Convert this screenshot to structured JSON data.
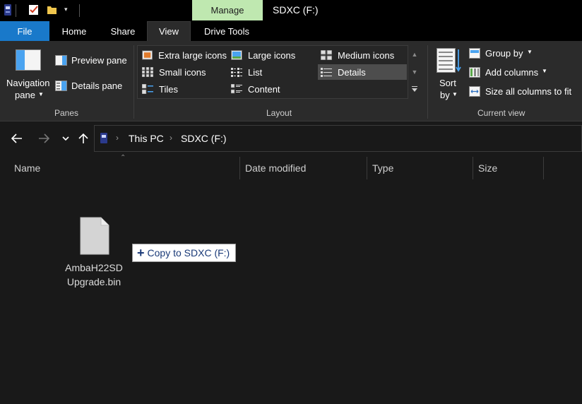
{
  "titlebar": {
    "context_tab": "Manage",
    "window_title": "SDXC (F:)"
  },
  "tabs": {
    "file": "File",
    "home": "Home",
    "share": "Share",
    "view": "View",
    "drive_tools": "Drive Tools"
  },
  "ribbon": {
    "panes": {
      "navigation_pane_line1": "Navigation",
      "navigation_pane_line2": "pane",
      "preview_pane": "Preview pane",
      "details_pane": "Details pane",
      "group_label": "Panes"
    },
    "layout": {
      "items": [
        "Extra large icons",
        "Large icons",
        "Medium icons",
        "Small icons",
        "List",
        "Details",
        "Tiles",
        "Content"
      ],
      "selected": "Details",
      "group_label": "Layout"
    },
    "current_view": {
      "sort_by_line1": "Sort",
      "sort_by_line2": "by",
      "group_by": "Group by",
      "add_columns": "Add columns",
      "size_all_columns": "Size all columns to fit",
      "group_label": "Current view"
    }
  },
  "address": {
    "crumbs": [
      "This PC",
      "SDXC (F:)"
    ]
  },
  "columns": [
    "Name",
    "Date modified",
    "Type",
    "Size"
  ],
  "file": {
    "name_line1": "AmbaH22SD",
    "name_line2": "Upgrade.bin"
  },
  "drag_tooltip": "Copy to SDXC (F:)",
  "colors": {
    "accent": "#1979ca",
    "manage_tab": "#bfe8b0",
    "background": "#191919",
    "ribbon": "#2b2b2b"
  }
}
